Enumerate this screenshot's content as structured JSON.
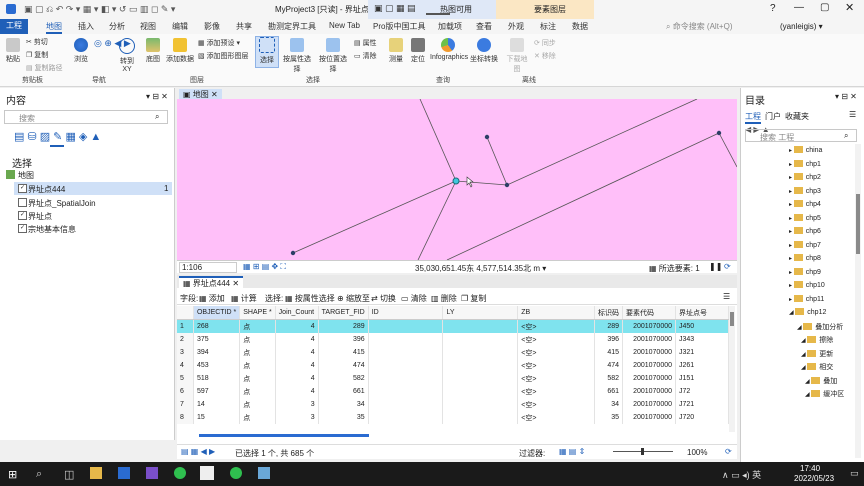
{
  "app": {
    "title": "MyProject3 [只读] - 界址点444 - ArcGIS Pro",
    "contextual_tabs": {
      "attr": "热图可用",
      "layer": "要素图层"
    }
  },
  "ribbon_tabs": [
    "工程",
    "地图",
    "插入",
    "分析",
    "视图",
    "编辑",
    "影像",
    "共享",
    "勘测定界工具",
    "New Tab",
    "Pro版中国工具",
    "加载项",
    "查看",
    "外观",
    "标注",
    "数据"
  ],
  "ribbon_search_placeholder": "命令搜索 (Alt+Q)",
  "user": "(yanleigis) ▾",
  "ribbon": {
    "clipboard": {
      "paste": "粘贴",
      "cut": "剪切",
      "copy": "复制",
      "copy_path": "复制路径",
      "group": "剪贴板"
    },
    "navigate": {
      "explore": "浏览",
      "go_to_xy": "转到XY",
      "group": "导航"
    },
    "layer": {
      "basemap": "底图",
      "add_data": "添加数据",
      "add_preset": "添加预设 ▾",
      "add_graphics_layer": "添加图形图层",
      "group": "图层"
    },
    "selection": {
      "select": "选择",
      "by_attr": "按属性选择",
      "by_loc": "按位置选择",
      "attributes": "属性",
      "clear": "清除",
      "group": "选择"
    },
    "inquiry": {
      "measure": "测量",
      "locate": "定位",
      "infographics": "Infographics",
      "coord": "坐标转换",
      "group": "查询"
    },
    "offline": {
      "download": "下载地图",
      "sync": "同步",
      "remove": "移除",
      "group": "离线"
    }
  },
  "contents": {
    "title": "内容",
    "search_placeholder": "搜索",
    "section": "选择",
    "map_node": "地图",
    "layers": [
      {
        "name": "界址点444",
        "checked": true,
        "count": "1",
        "selected": true
      },
      {
        "name": "界址点_SpatialJoin",
        "checked": false,
        "count": "",
        "selected": false
      },
      {
        "name": "界址点",
        "checked": true,
        "count": "",
        "selected": false
      },
      {
        "name": "宗地基本信息",
        "checked": true,
        "count": "",
        "selected": false
      }
    ]
  },
  "map_tab": "地图",
  "map_status": {
    "scale": "1:106",
    "coords": "35,030,651.45东 4,577,514.35北 m ▾",
    "selected": "所选要素: 1"
  },
  "table": {
    "tab": "界址点444",
    "toolbar": {
      "field": "字段:",
      "add": "添加",
      "calculate": "计算",
      "selection": "选择:",
      "by_attr": "按属性选择",
      "zoom_to": "缩放至",
      "switch": "切换",
      "clear": "清除",
      "delete": "删除",
      "copy": "复制"
    },
    "columns": [
      "OBJECTID *",
      "SHAPE *",
      "Join_Count",
      "TARGET_FID",
      "ID",
      "LY",
      "ZB",
      "标识码",
      "要素代码",
      "界址点号"
    ],
    "rows": [
      [
        "1",
        "268",
        "点",
        "4",
        "289",
        "",
        "",
        "<空>",
        "289",
        "2001070000",
        "J450"
      ],
      [
        "2",
        "375",
        "点",
        "4",
        "396",
        "",
        "",
        "<空>",
        "396",
        "2001070000",
        "J343"
      ],
      [
        "3",
        "394",
        "点",
        "4",
        "415",
        "",
        "",
        "<空>",
        "415",
        "2001070000",
        "J321"
      ],
      [
        "4",
        "453",
        "点",
        "4",
        "474",
        "",
        "",
        "<空>",
        "474",
        "2001070000",
        "J261"
      ],
      [
        "5",
        "518",
        "点",
        "4",
        "582",
        "",
        "",
        "<空>",
        "582",
        "2001070000",
        "J151"
      ],
      [
        "6",
        "597",
        "点",
        "4",
        "661",
        "",
        "",
        "<空>",
        "661",
        "2001070000",
        "J72"
      ],
      [
        "7",
        "14",
        "点",
        "3",
        "34",
        "",
        "",
        "<空>",
        "34",
        "2001070000",
        "J721"
      ],
      [
        "8",
        "15",
        "点",
        "3",
        "35",
        "",
        "",
        "<空>",
        "35",
        "2001070000",
        "J720"
      ]
    ],
    "footer": {
      "selected": "已选择 1 个, 共 685 个",
      "filter": "过滤器:",
      "zoom": "100%"
    }
  },
  "catalog": {
    "title": "目录",
    "tabs": [
      "工程",
      "门户",
      "收藏夹"
    ],
    "search_placeholder": "搜索 工程",
    "items": [
      "china",
      "chp1",
      "chp2",
      "chp3",
      "chp4",
      "chp5",
      "chp6",
      "chp7",
      "chp8",
      "chp9",
      "chp10",
      "chp11",
      "chp12",
      "叠加分析",
      "擦除",
      "更新",
      "相交",
      "叠加",
      "缓冲区"
    ]
  },
  "taskbar": {
    "time": "17:40",
    "date": "2022/05/23"
  }
}
